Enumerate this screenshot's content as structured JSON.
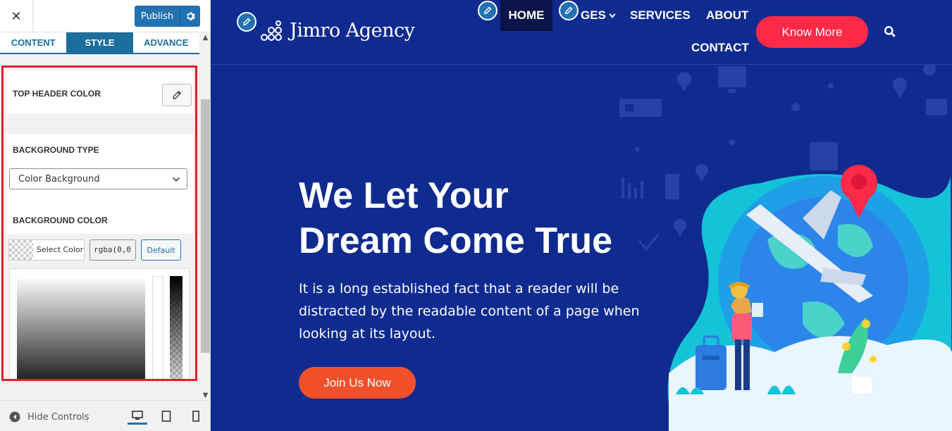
{
  "sidebar": {
    "close_label": "✕",
    "publish_label": "Publish",
    "tabs": [
      {
        "label": "CONTENT"
      },
      {
        "label": "STYLE"
      },
      {
        "label": "ADVANCE"
      }
    ],
    "active_tab": "STYLE",
    "top_header_color_label": "TOP HEADER COLOR",
    "background_type_label": "BACKGROUND TYPE",
    "background_type_value": "Color Background",
    "background_color_label": "BACKGROUND COLOR",
    "select_color_label": "Select Color",
    "color_value": "rgba(0,0",
    "default_label": "Default",
    "hide_controls_label": "Hide Controls"
  },
  "site": {
    "logo_text": "Jimro Agency",
    "nav": {
      "home": "HOME",
      "pages": "GES",
      "services": "SERVICES",
      "about": "ABOUT",
      "contact": "CONTACT"
    },
    "cta_label": "Know More",
    "hero_title_line1": "We Let Your",
    "hero_title_line2": "Dream Come True",
    "hero_text": "It is a long established fact that a reader will be distracted by the readable content of a page when looking at its layout.",
    "join_label": "Join Us Now"
  },
  "colors": {
    "hero_bg": "#0f2b8f",
    "accent": "#ff2a48",
    "join": "#f2502a",
    "wp_blue": "#2271b1",
    "highlight_border": "#e01f26"
  },
  "icons": [
    "close-icon",
    "gear-icon",
    "pencil-icon",
    "chevron-down-icon",
    "search-icon",
    "desktop-icon",
    "tablet-icon",
    "mobile-icon",
    "collapse-icon"
  ]
}
